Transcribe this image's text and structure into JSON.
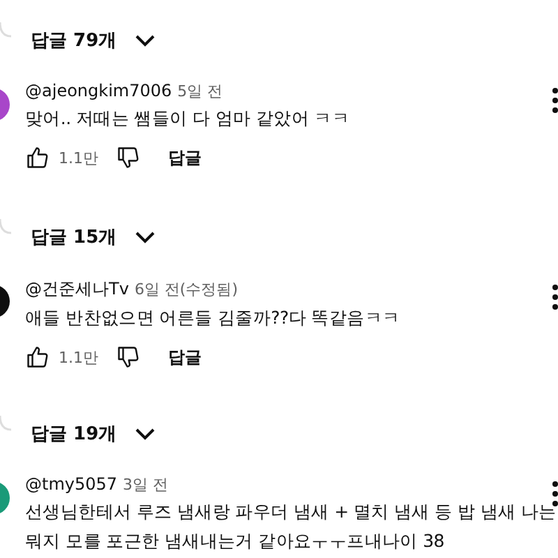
{
  "threads": [
    {
      "replies_toggle": "답글 79개",
      "comment": {
        "color": "#a846c9",
        "author": "@ajeongkim7006",
        "time": "5일 전",
        "text": [
          "맞어.. 저때는 쌤들이 다 엄마 같았어 ㅋㅋ"
        ],
        "likes": "1.1만",
        "reply": "답글"
      }
    },
    {
      "replies_toggle": "답글 15개",
      "comment": {
        "color": "#0f0f0f",
        "author": "@건준세나Tv",
        "time": "6일 전(수정됨)",
        "text": [
          "애들 반찬없으면 어른들 김줄까??다 똑같음ㅋㅋ"
        ],
        "likes": "1.1만",
        "reply": "답글"
      }
    },
    {
      "replies_toggle": "답글 19개",
      "comment": {
        "color": "#1a9a78",
        "author": "@tmy5057",
        "time": "3일 전",
        "text": [
          "선생님한테서 루즈 냄새랑 파우더 냄새 + 멸치 냄새 등 밥 냄새 나는",
          "뭐지 모를 포근한 냄새내는거 같아요ㅜㅜ프내나이 38"
        ]
      }
    }
  ]
}
